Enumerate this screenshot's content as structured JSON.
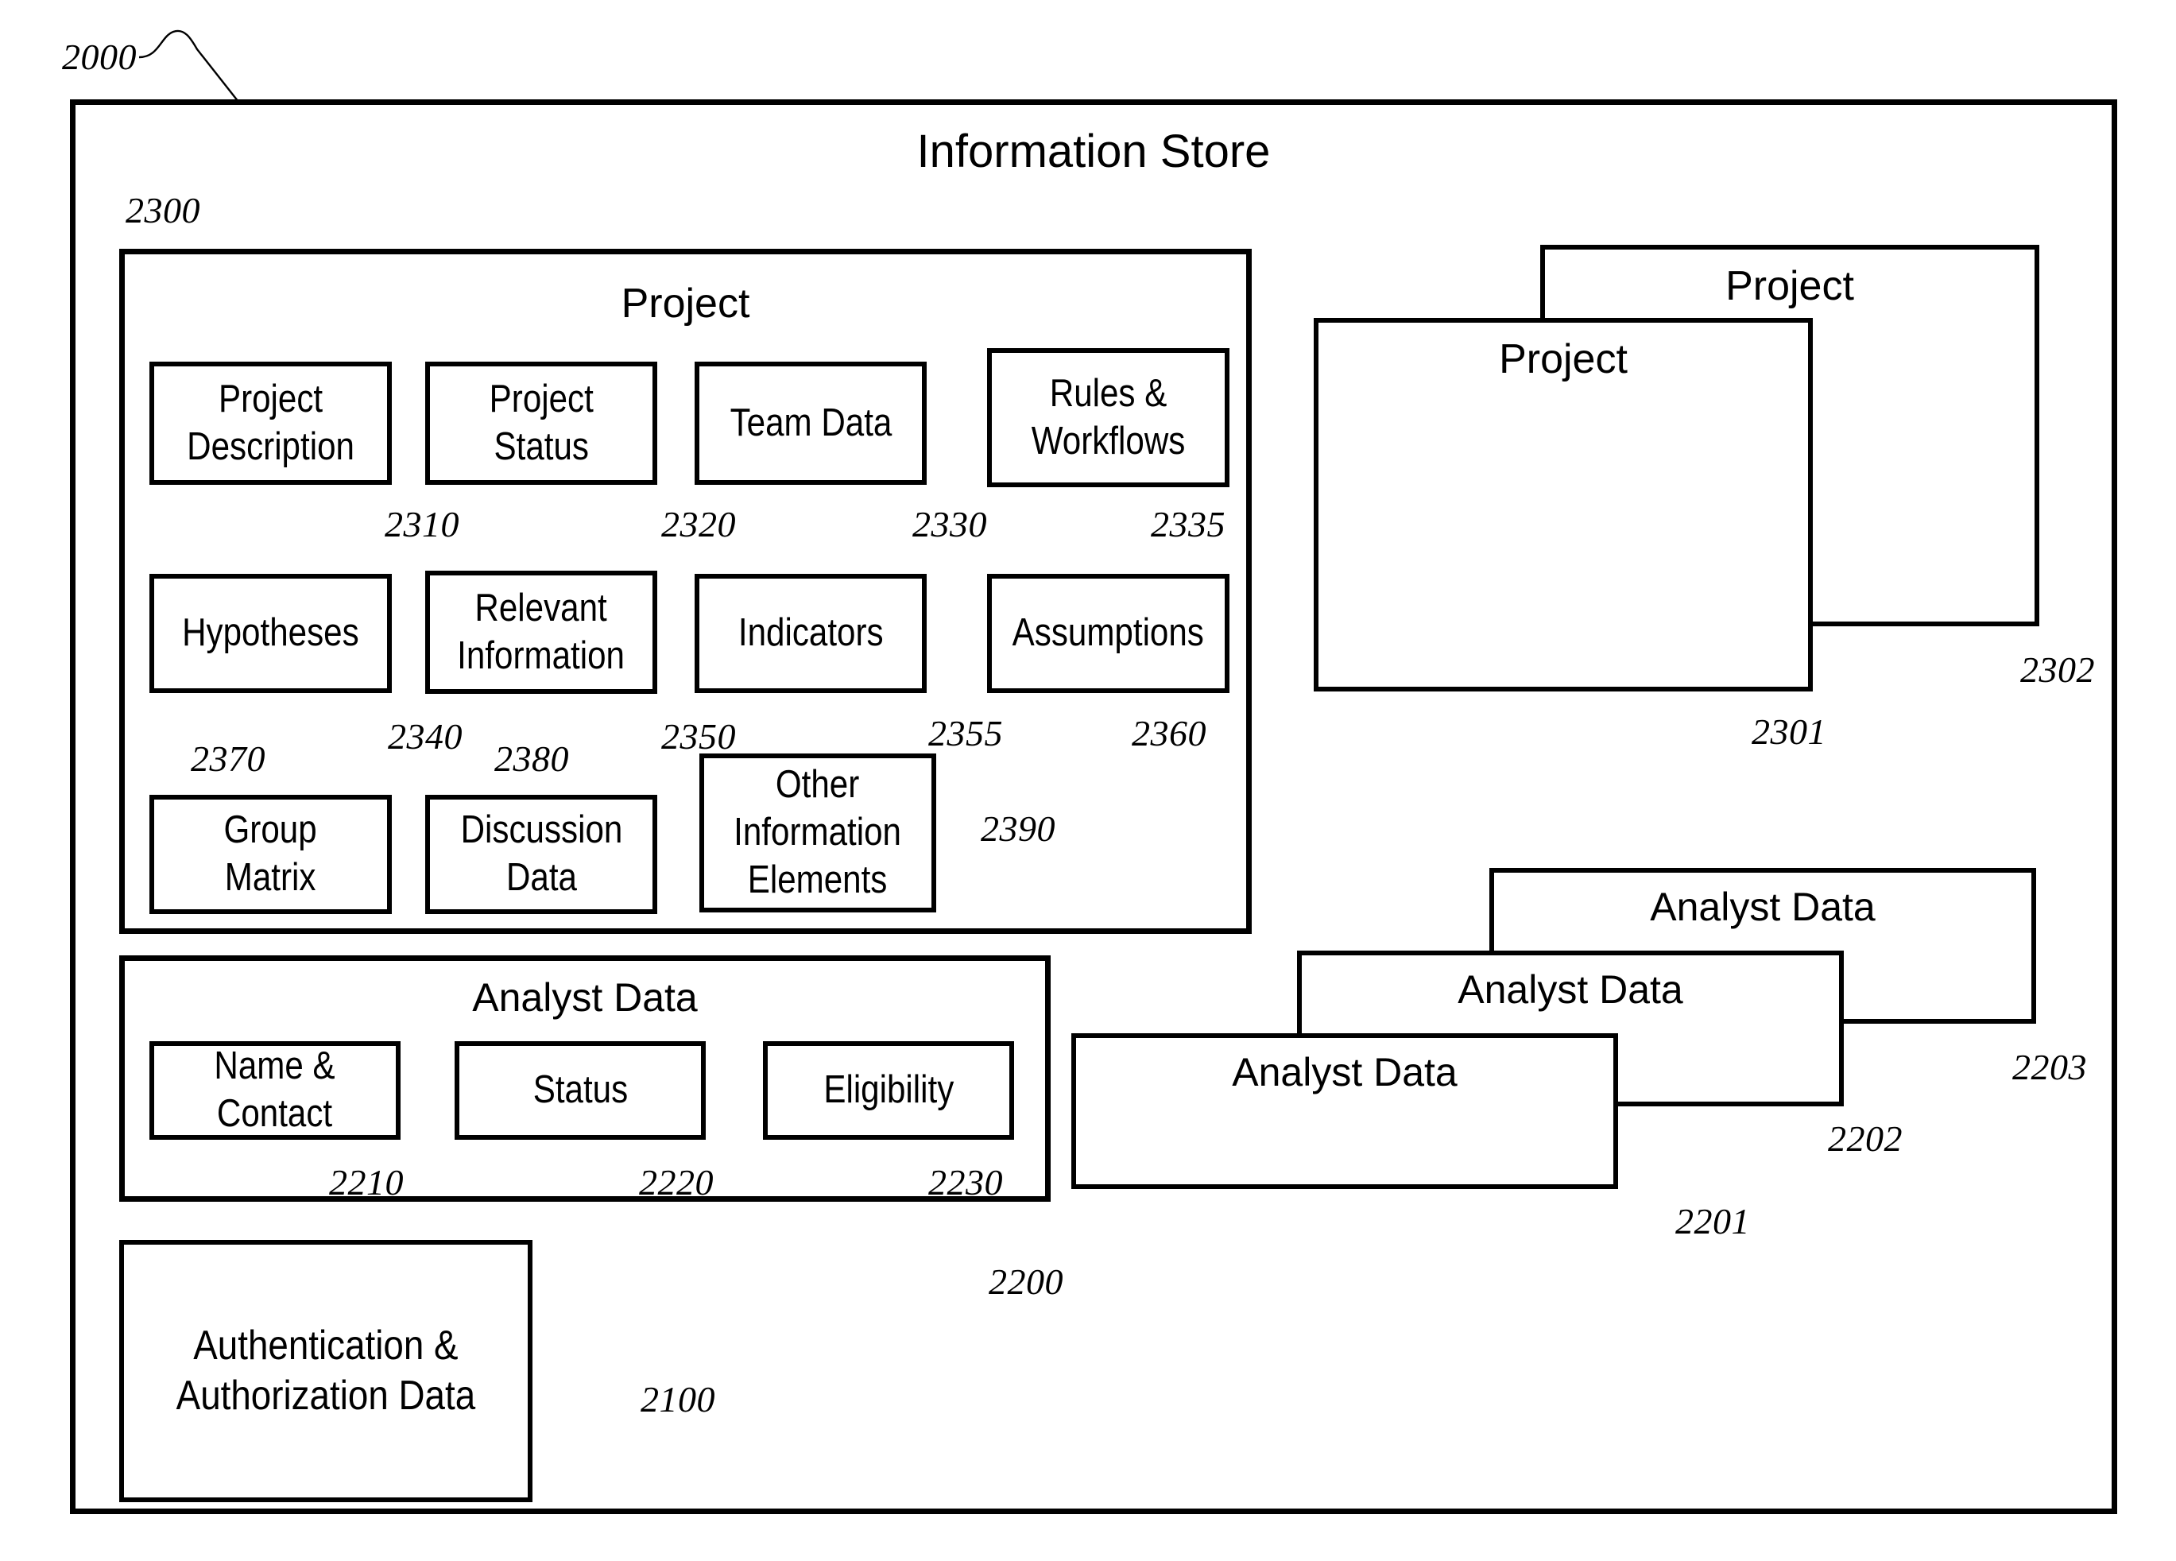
{
  "figure": {
    "outer_label": "2000",
    "outer_title": "Information Store"
  },
  "project_panel": {
    "ref": "2300",
    "title": "Project",
    "items": [
      {
        "label": "Project\nDescription",
        "ref": "2310"
      },
      {
        "label": "Project\nStatus",
        "ref": "2320"
      },
      {
        "label": "Team Data",
        "ref": "2330"
      },
      {
        "label": "Rules &\nWorkflows",
        "ref": "2335"
      },
      {
        "label": "Hypotheses",
        "ref": "2340"
      },
      {
        "label": "Relevant\nInformation",
        "ref": "2350"
      },
      {
        "label": "Indicators",
        "ref": "2355"
      },
      {
        "label": "Assumptions",
        "ref": "2360"
      },
      {
        "label": "Group\nMatrix",
        "ref": "2370"
      },
      {
        "label": "Discussion\nData",
        "ref": "2380"
      },
      {
        "label": "Other\nInformation\nElements",
        "ref": "2390"
      }
    ]
  },
  "project_stack": {
    "cards": [
      {
        "title": "Project",
        "ref": "2302"
      },
      {
        "title": "Project",
        "ref": "2301"
      }
    ]
  },
  "analyst_panel": {
    "ref": "2200",
    "title": "Analyst Data",
    "items": [
      {
        "label": "Name &\nContact",
        "ref": "2210"
      },
      {
        "label": "Status",
        "ref": "2220"
      },
      {
        "label": "Eligibility",
        "ref": "2230"
      }
    ]
  },
  "analyst_stack": {
    "cards": [
      {
        "title": "Analyst Data",
        "ref": "2203"
      },
      {
        "title": "Analyst Data",
        "ref": "2202"
      },
      {
        "title": "Analyst Data",
        "ref": "2201"
      }
    ]
  },
  "auth_box": {
    "label": "Authentication &\nAuthorization Data",
    "ref": "2100"
  },
  "colors": {
    "stroke": "#000000",
    "background": "#ffffff"
  }
}
